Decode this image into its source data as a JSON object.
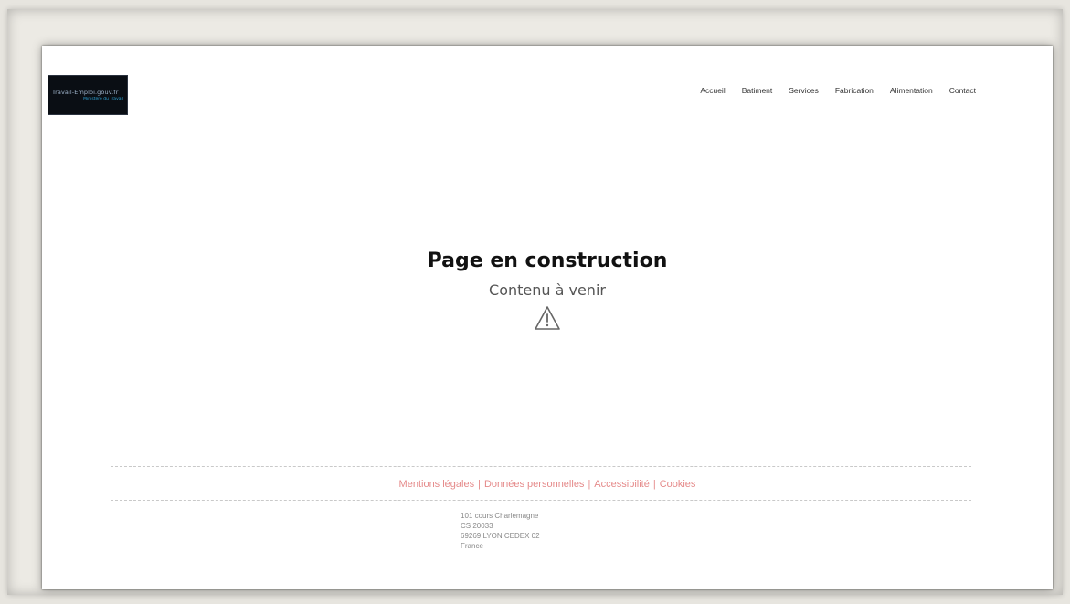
{
  "header": {
    "logo": {
      "line1": "Travail-Emploi.gouv.fr",
      "line2": "Ministère du Travail"
    },
    "nav": [
      "Accueil",
      "Batiment",
      "Services",
      "Fabrication",
      "Alimentation",
      "Contact"
    ]
  },
  "main": {
    "title": "Page en construction",
    "subtitle": "Contenu à venir",
    "icon": "warning-triangle-icon"
  },
  "footer": {
    "links": [
      "Mentions légales",
      "Données personnelles",
      "Accessibilité",
      "Cookies"
    ],
    "link_color": "#e58a8a",
    "address": [
      "101 cours Charlemagne",
      "CS 20033",
      "69269 LYON CEDEX 02",
      "France"
    ]
  }
}
